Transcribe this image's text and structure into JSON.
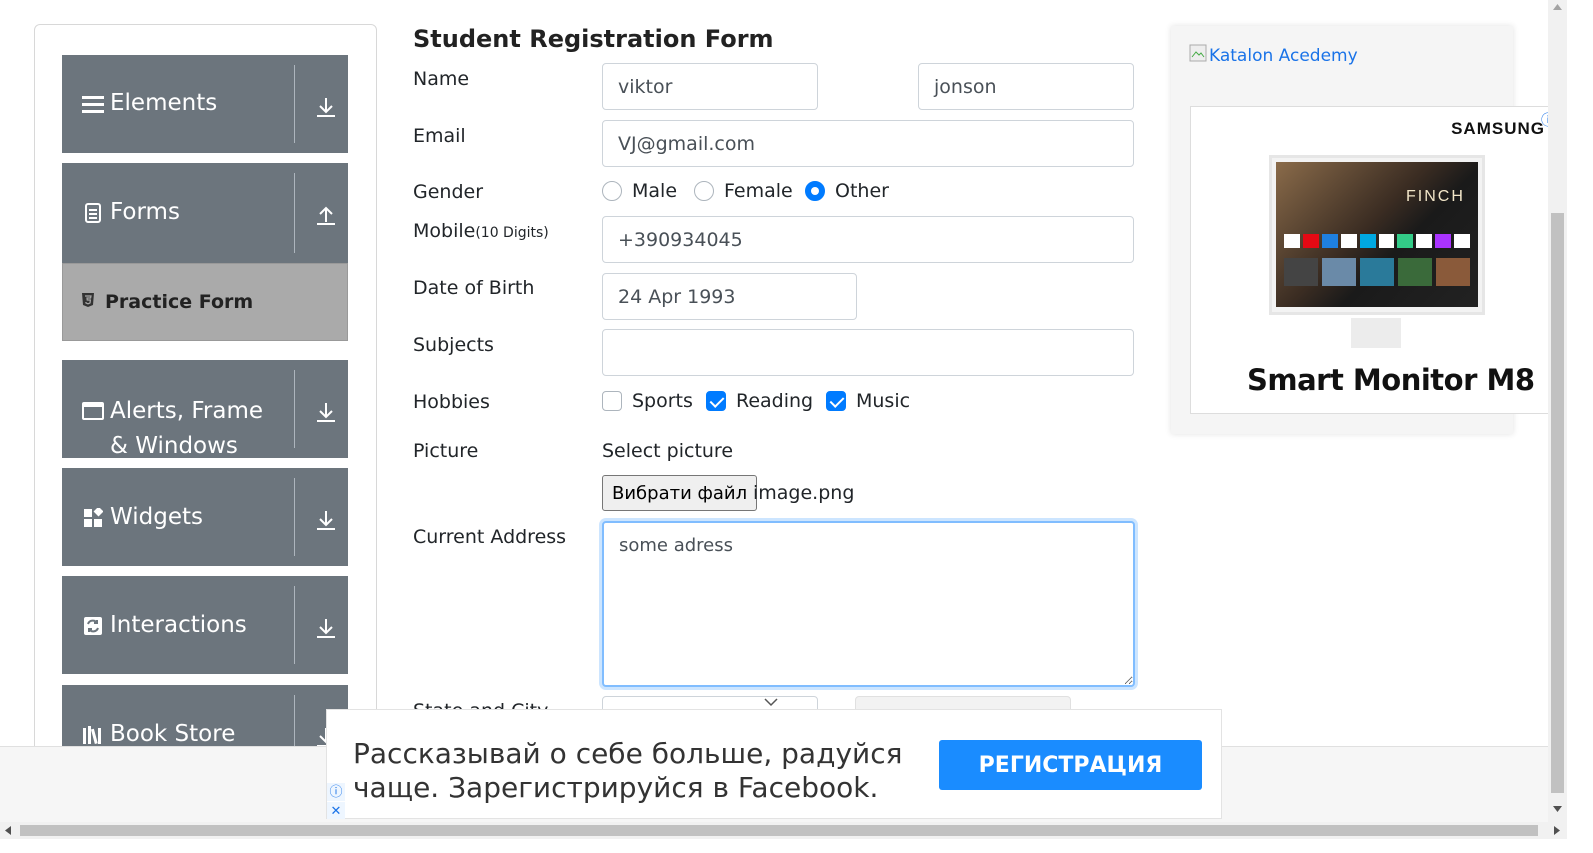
{
  "sidebar": {
    "groups": [
      {
        "label": "Elements",
        "icon": "hamburger-icon",
        "arrow": "down"
      },
      {
        "label": "Forms",
        "icon": "document-icon",
        "arrow": "up"
      },
      {
        "label": "Alerts, Frame & Windows",
        "icon": "window-icon",
        "arrow": "down"
      },
      {
        "label": "Widgets",
        "icon": "widgets-icon",
        "arrow": "down"
      },
      {
        "label": "Interactions",
        "icon": "interactions-icon",
        "arrow": "down"
      },
      {
        "label": "Book Store",
        "icon": "books-icon",
        "arrow": "down"
      }
    ],
    "active_item": "Practice Form"
  },
  "form": {
    "title": "Student Registration Form",
    "labels": {
      "name": "Name",
      "email": "Email",
      "gender": "Gender",
      "mobile": "Mobile",
      "mobile_hint": "(10 Digits)",
      "dob": "Date of Birth",
      "subjects": "Subjects",
      "hobbies": "Hobbies",
      "picture": "Picture",
      "address": "Current Address",
      "state_city": "State and City"
    },
    "first_name": "viktor",
    "last_name": "jonson",
    "email": "VJ@gmail.com",
    "gender_options": [
      "Male",
      "Female",
      "Other"
    ],
    "gender_selected": "Other",
    "mobile": "+390934045",
    "dob": "24 Apr 1993",
    "subjects": "",
    "hobbies": [
      {
        "label": "Sports",
        "checked": false
      },
      {
        "label": "Reading",
        "checked": true
      },
      {
        "label": "Music",
        "checked": true
      }
    ],
    "picture_label": "Select picture",
    "file_button": "Вибрати файл",
    "file_name": "image.png",
    "address": "some adress"
  },
  "ad_right": {
    "link_text": "Katalon Acedemy",
    "brand": "SAMSUNG",
    "product": "Smart Monitor M8",
    "poster_title": "FINCH"
  },
  "ad_bottom": {
    "text": "Рассказывай о себе больше, радуйся чаще. Зарегистрируйся в Facebook.",
    "cta": "РЕГИСТРАЦИЯ"
  },
  "colors": {
    "sidebar_group": "#6c757d",
    "active_item": "#aaaaaa",
    "accent": "#007bff",
    "cta": "#1a8cff"
  }
}
